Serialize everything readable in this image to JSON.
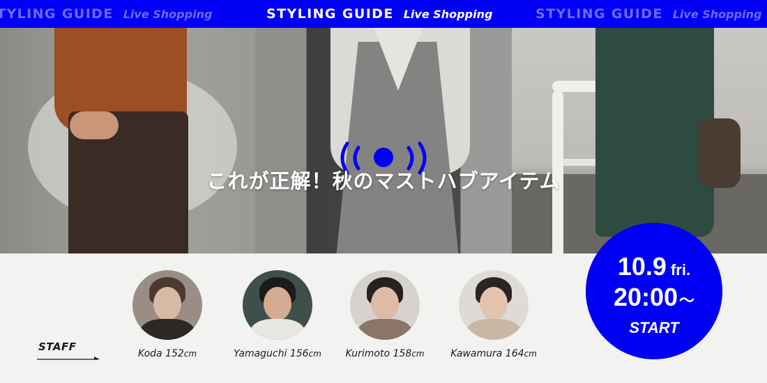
{
  "banner": {
    "title": "STYLING GUIDE",
    "subtitle": "Live Shopping",
    "background_color": "#0000f5"
  },
  "hero": {
    "headline": "これが正解！秋のマストハブアイテム",
    "live_icon": "live-broadcast-icon"
  },
  "staff": {
    "label": "STAFF",
    "members": [
      {
        "name": "Koda",
        "height": "152",
        "unit": "cm"
      },
      {
        "name": "Yamaguchi",
        "height": "156",
        "unit": "cm"
      },
      {
        "name": "Kurimoto",
        "height": "158",
        "unit": "cm"
      },
      {
        "name": "Kawamura",
        "height": "164",
        "unit": "cm"
      }
    ]
  },
  "badge": {
    "date": "10.9",
    "day": "fri.",
    "time": "20:00",
    "tilde": "〜",
    "start": "START",
    "color": "#0000f5"
  }
}
